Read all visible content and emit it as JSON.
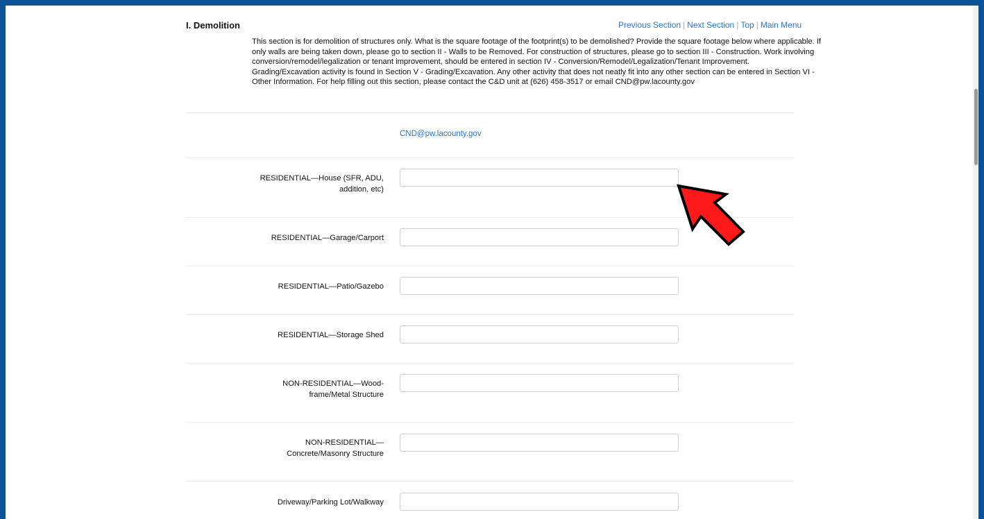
{
  "section": {
    "title": "I. Demolition",
    "nav": {
      "previous": "Previous Section",
      "next": "Next Section",
      "top": "Top",
      "main_menu": "Main Menu",
      "separator": "|"
    },
    "intro_lines": [
      "This section is for demolition of structures only. What is the square footage of the footprint(s) to be demolished? Provide the square footage below where applicable. If",
      "only walls are being taken down, please go to section II - Walls to be Removed. For construction of structures, please go to section III - Construction. Work involving",
      "conversion/remodel/legalization or tenant improvement, should be entered in section IV - Conversion/Remodel/Legalization/Tenant Improvement.",
      "Grading/Excavation activity is found in Section V - Grading/Excavation. Any other activity that does not neatly fit into any other section can be entered in Section VI -",
      "Other Information. For help filling out this section, please contact the C&D unit at (626) 458-3517 or email CND@pw.lacounty.gov"
    ],
    "email": "CND@pw.lacounty.gov"
  },
  "fields": [
    {
      "label_lines": [
        "RESIDENTIAL—House (SFR, ADU,",
        "addition, etc)"
      ],
      "value": "",
      "placeholder": ""
    },
    {
      "label_lines": [
        "RESIDENTIAL—Garage/Carport"
      ],
      "value": "",
      "placeholder": ""
    },
    {
      "label_lines": [
        "RESIDENTIAL—Patio/Gazebo"
      ],
      "value": "",
      "placeholder": ""
    },
    {
      "label_lines": [
        "RESIDENTIAL—Storage Shed"
      ],
      "value": "",
      "placeholder": ""
    },
    {
      "label_lines": [
        "NON-RESIDENTIAL—Wood-",
        "frame/Metal Structure"
      ],
      "value": "",
      "placeholder": ""
    },
    {
      "label_lines": [
        "NON-RESIDENTIAL—",
        "Concrete/Masonry Structure"
      ],
      "value": "",
      "placeholder": ""
    },
    {
      "label_lines": [
        "Driveway/Parking Lot/Walkway"
      ],
      "value": "",
      "placeholder": ""
    }
  ],
  "annotation": {
    "icon": "red-arrow-icon",
    "color": "#ff1a1a"
  }
}
